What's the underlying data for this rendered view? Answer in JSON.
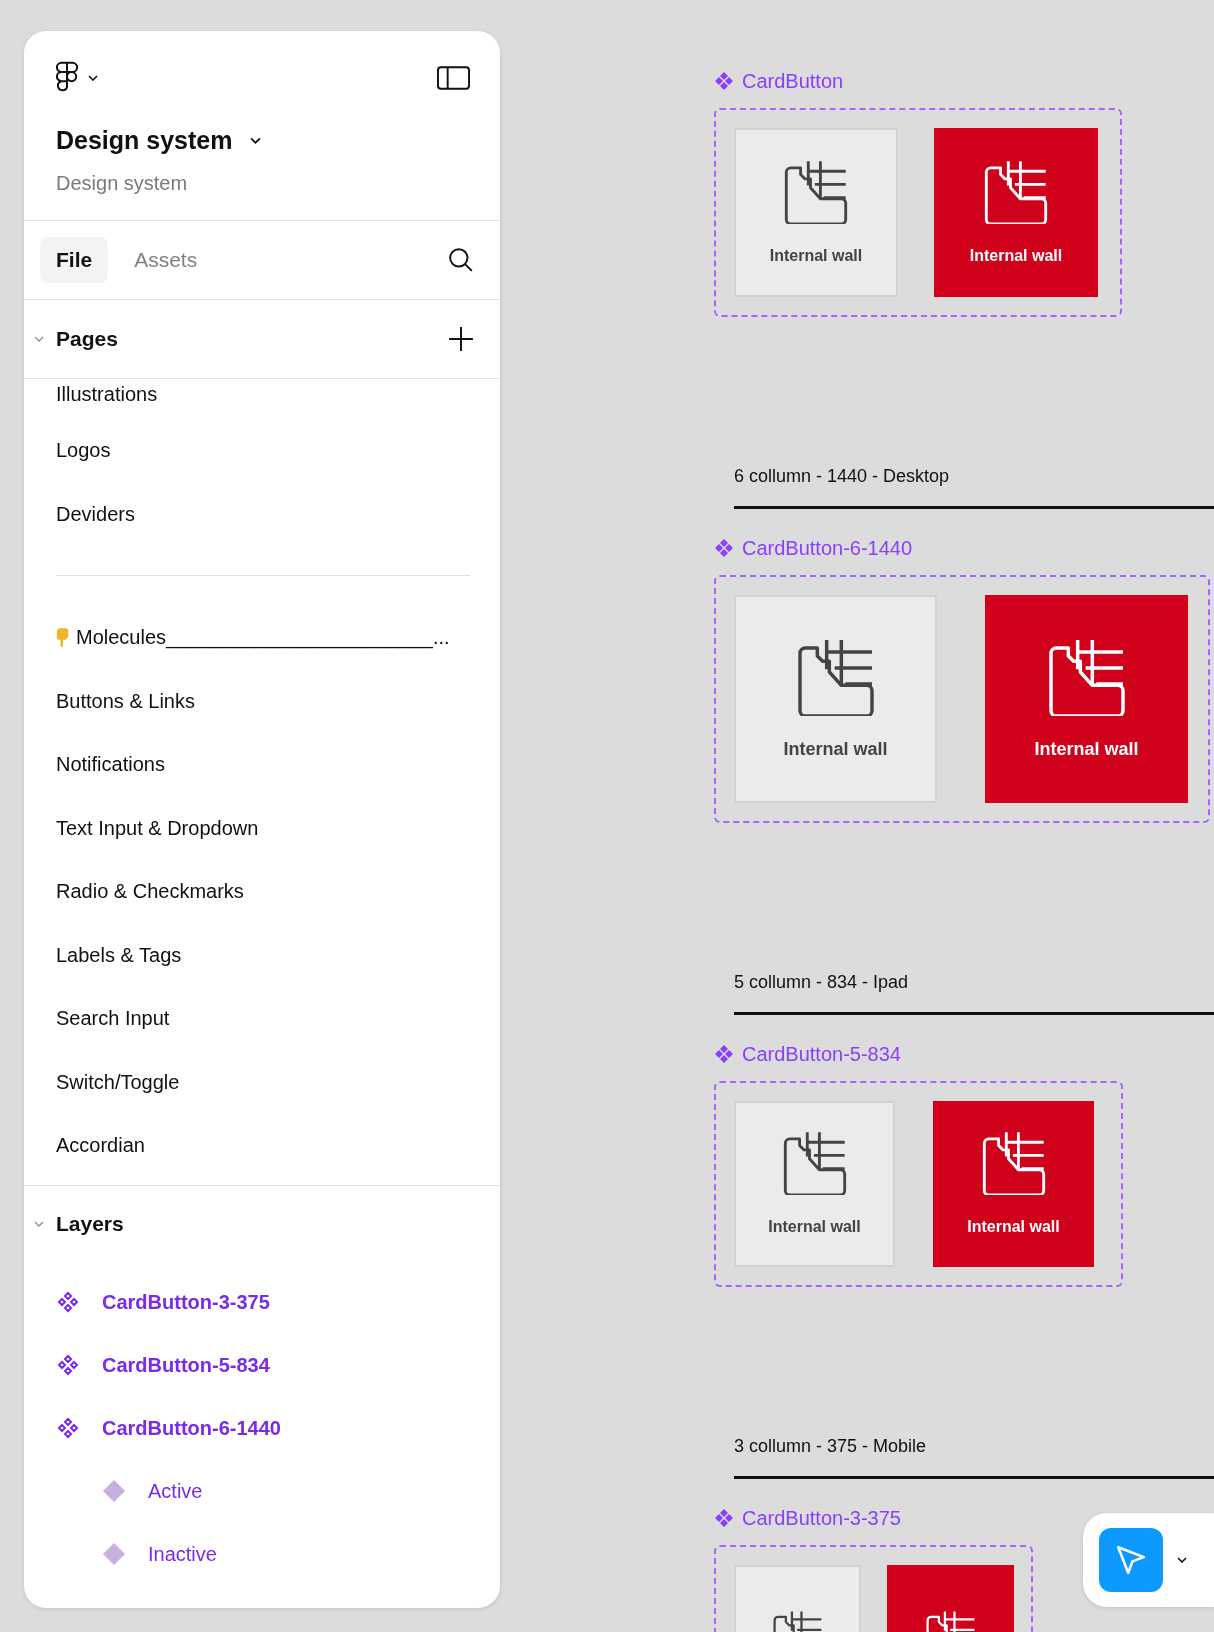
{
  "sidebar": {
    "file_title": "Design system",
    "project": "Design system",
    "tabs": [
      {
        "label": "File",
        "selected": true
      },
      {
        "label": "Assets",
        "selected": false
      }
    ],
    "pages": {
      "title": "Pages",
      "expanded": true,
      "items": [
        {
          "kind": "page",
          "label": "Illustrations"
        },
        {
          "kind": "page",
          "label": "Logos"
        },
        {
          "kind": "page",
          "label": "Deviders"
        },
        {
          "kind": "divider"
        },
        {
          "kind": "section",
          "label": "Molecules________________________..."
        },
        {
          "kind": "page",
          "label": "Buttons & Links"
        },
        {
          "kind": "page",
          "label": "Notifications"
        },
        {
          "kind": "page",
          "label": "Text Input & Dropdown"
        },
        {
          "kind": "page",
          "label": "Radio & Checkmarks"
        },
        {
          "kind": "page",
          "label": "Labels & Tags"
        },
        {
          "kind": "page",
          "label": "Search Input"
        },
        {
          "kind": "page",
          "label": "Switch/Toggle"
        },
        {
          "kind": "page",
          "label": "Accordian"
        }
      ]
    },
    "layers": {
      "title": "Layers",
      "expanded": true,
      "items": [
        {
          "kind": "component",
          "label": "CardButton-3-375"
        },
        {
          "kind": "component",
          "label": "CardButton-5-834"
        },
        {
          "kind": "component",
          "label": "CardButton-6-1440",
          "children": [
            {
              "kind": "variant",
              "label": "Active"
            },
            {
              "kind": "variant",
              "label": "Inactive"
            }
          ]
        }
      ]
    }
  },
  "canvas": {
    "groups": [
      {
        "title": "CardButton",
        "cards": [
          {
            "label": "Internal wall",
            "active": false
          },
          {
            "label": "Internal wall",
            "active": true
          }
        ]
      },
      {
        "heading": "6 collumn - 1440 - Desktop",
        "title": "CardButton-6-1440",
        "cards": [
          {
            "label": "Internal wall",
            "active": false
          },
          {
            "label": "Internal wall",
            "active": true
          }
        ]
      },
      {
        "heading": "5 collumn - 834 - Ipad",
        "title": "CardButton-5-834",
        "cards": [
          {
            "label": "Internal wall",
            "active": false
          },
          {
            "label": "Internal wall",
            "active": true
          }
        ]
      },
      {
        "heading": "3 collumn - 375 - Mobile",
        "title": "CardButton-3-375",
        "cards": [
          {
            "active": false
          },
          {
            "active": true
          }
        ]
      }
    ]
  }
}
